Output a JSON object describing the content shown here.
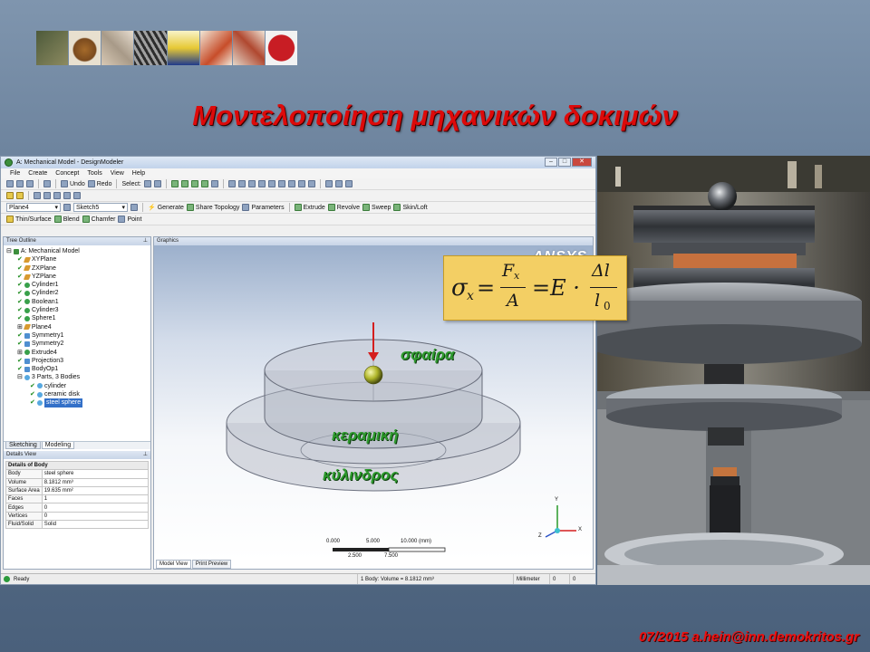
{
  "slide": {
    "title": "Μοντελοποίηση μηχανικών δοκιμών",
    "footer": "07/2015 a.hein@inn.demokritos.gr"
  },
  "app": {
    "window_title": "A: Mechanical Model - DesignModeler",
    "menu": [
      "File",
      "Create",
      "Concept",
      "Tools",
      "View",
      "Help"
    ],
    "toolbar1": {
      "undo": "Undo",
      "redo": "Redo",
      "select": "Select:"
    },
    "toolbar3": {
      "plane_combo": "Plane4",
      "sketch_combo": "Sketch5",
      "generate": "Generate",
      "share_topology": "Share Topology",
      "parameters": "Parameters",
      "extrude": "Extrude",
      "revolve": "Revolve",
      "sweep": "Sweep",
      "skin_loft": "Skin/Loft"
    },
    "toolbar4": {
      "thin_surface": "Thin/Surface",
      "blend": "Blend",
      "chamfer": "Chamfer",
      "point": "Point"
    },
    "tree_outline": {
      "header": "Tree Outline",
      "root": "A: Mechanical Model",
      "items": [
        "XYPlane",
        "ZXPlane",
        "YZPlane",
        "Cylinder1",
        "Cylinder2",
        "Boolean1",
        "Cylinder3",
        "Sphere1",
        "Plane4",
        "Symmetry1",
        "Symmetry2",
        "Extrude4",
        "Projection3",
        "BodyOp1"
      ],
      "parts_group": "3 Parts, 3 Bodies",
      "bodies": [
        "cylinder",
        "ceramic disk",
        "steel sphere"
      ]
    },
    "left_tabs": {
      "sketching": "Sketching",
      "modeling": "Modeling"
    },
    "details_view": {
      "header": "Details View",
      "section": "Details of Body",
      "rows": [
        {
          "key": "Body",
          "value": "steel sphere"
        },
        {
          "key": "Volume",
          "value": "8.1812 mm³"
        },
        {
          "key": "Surface Area",
          "value": "19.635 mm²"
        },
        {
          "key": "Faces",
          "value": "1"
        },
        {
          "key": "Edges",
          "value": "0"
        },
        {
          "key": "Vertices",
          "value": "0"
        },
        {
          "key": "Fluid/Solid",
          "value": "Solid"
        }
      ]
    },
    "graphics": {
      "header": "Graphics",
      "logo": "ANSYS",
      "labels": {
        "sphere": "σφαίρα",
        "ceramic": "κεραμική",
        "cylinder": "κύλινδρος"
      },
      "scale": {
        "top": [
          "0.000",
          "5.000",
          "10.000 (mm)"
        ],
        "bottom": [
          "2.500",
          "7.500"
        ]
      },
      "axes": {
        "x": "X",
        "y": "Y",
        "z": "Z"
      },
      "tabs": {
        "model_view": "Model View",
        "print_preview": "Print Preview"
      }
    },
    "statusbar": {
      "ready": "Ready",
      "selection": "1 Body: Volume = 8.1812 mm³",
      "units": "Millimeter",
      "a": "0",
      "b": "0"
    }
  },
  "formula": {
    "lhs": "σ",
    "sub_x": "x",
    "eq": "=",
    "num": "F",
    "num_sub": "x",
    "den": "A",
    "eq2": "=E ·",
    "dl": "Δl",
    "l0": "l",
    "l0_sub": "0"
  },
  "colors": {
    "title_red": "#dd0a0a",
    "label_green": "#2d9a2d",
    "background": "#5e7590",
    "formula_bg": "#f3cf64"
  }
}
